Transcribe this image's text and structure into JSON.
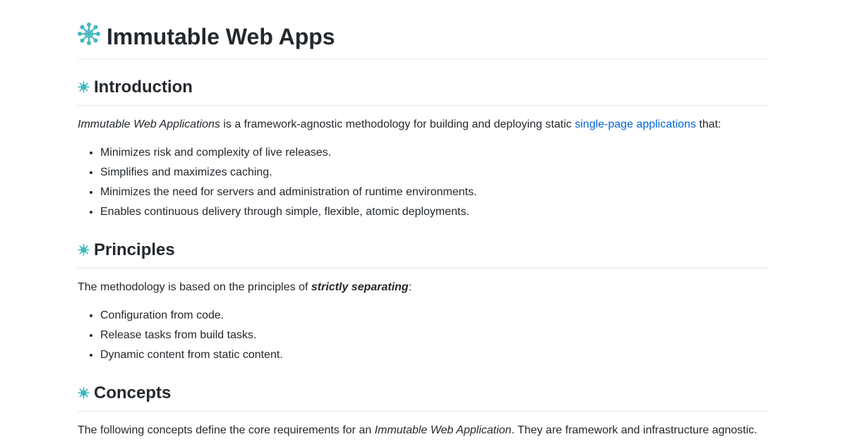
{
  "header": {
    "title": "Immutable Web Apps",
    "logo_icon": "snowflake-icon",
    "accent_color": "#3fb8c0"
  },
  "introduction": {
    "heading": "Introduction",
    "para": {
      "em": "Immutable Web Applications",
      "text_before_link": " is a framework-agnostic methodology for building and deploying static ",
      "link": "single-page applications",
      "text_after_link": " that:"
    },
    "items": [
      "Minimizes risk and complexity of live releases.",
      "Simplifies and maximizes caching.",
      "Minimizes the need for servers and administration of runtime environments.",
      "Enables continuous delivery through simple, flexible, atomic deployments."
    ]
  },
  "principles": {
    "heading": "Principles",
    "para": {
      "text_before": "The methodology is based on the principles of ",
      "strong_em": "strictly separating",
      "text_after": ":"
    },
    "items": [
      "Configuration from code.",
      "Release tasks from build tasks.",
      "Dynamic content from static content."
    ]
  },
  "concepts": {
    "heading": "Concepts",
    "para": {
      "text_before": "The following concepts define the core requirements for an ",
      "em": "Immutable Web Application",
      "text_after": ". They are framework and infrastructure agnostic."
    }
  }
}
